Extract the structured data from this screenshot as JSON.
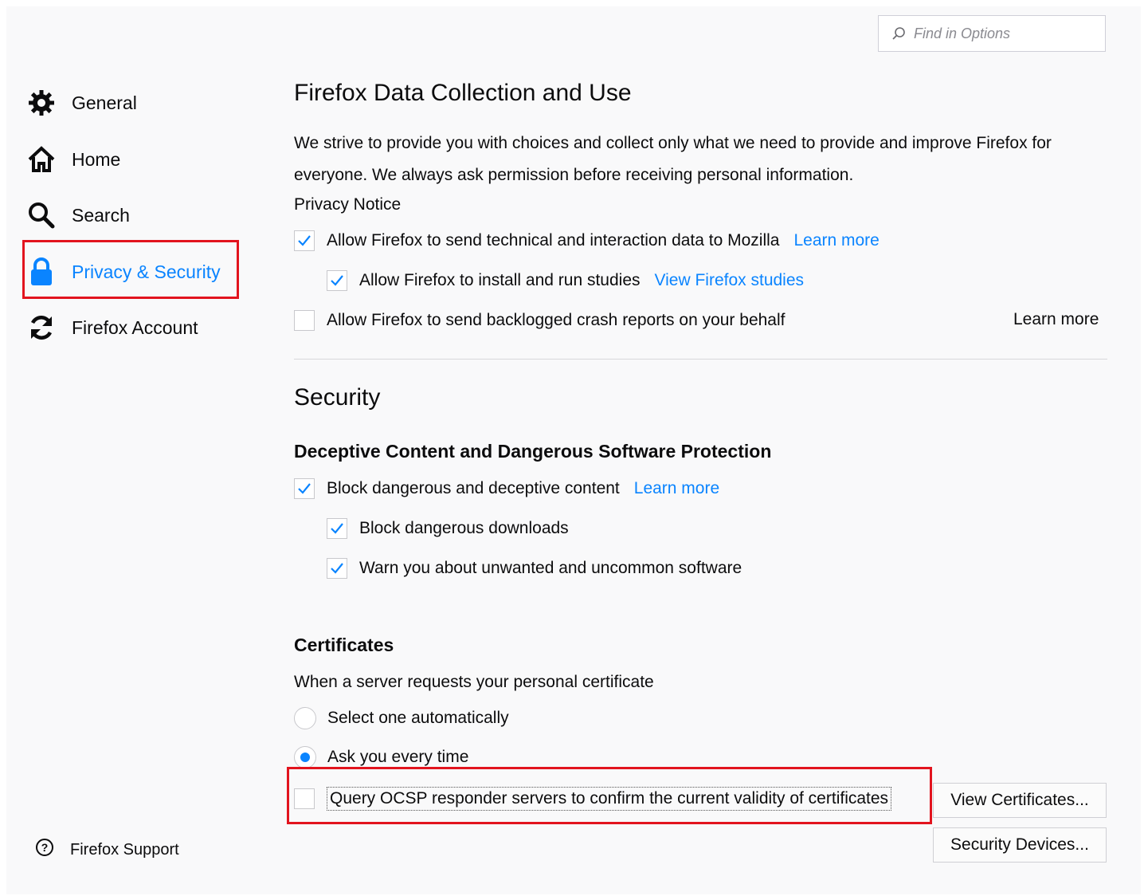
{
  "search": {
    "placeholder": "Find in Options"
  },
  "sidebar": {
    "items": [
      {
        "label": "General",
        "icon": "gear-icon"
      },
      {
        "label": "Home",
        "icon": "home-icon"
      },
      {
        "label": "Search",
        "icon": "search-icon"
      },
      {
        "label": "Privacy & Security",
        "icon": "lock-icon",
        "selected": true
      },
      {
        "label": "Firefox Account",
        "icon": "sync-icon"
      }
    ],
    "support_label": "Firefox Support"
  },
  "data_collection": {
    "title": "Firefox Data Collection and Use",
    "description": "We strive to provide you with choices and collect only what we need to provide and improve Firefox for everyone. We always ask permission before receiving personal information.",
    "privacy_notice_link": "Privacy Notice",
    "options": [
      {
        "label": "Allow Firefox to send technical and interaction data to Mozilla",
        "checked": true,
        "link": "Learn more"
      },
      {
        "label": "Allow Firefox to install and run studies",
        "checked": true,
        "link": "View Firefox studies"
      },
      {
        "label": "Allow Firefox to send backlogged crash reports on your behalf",
        "checked": false,
        "link": "Learn more"
      }
    ]
  },
  "security": {
    "title": "Security",
    "deceptive": {
      "heading": "Deceptive Content and Dangerous Software Protection",
      "options": [
        {
          "label": "Block dangerous and deceptive content",
          "checked": true,
          "link": "Learn more"
        },
        {
          "label": "Block dangerous downloads",
          "checked": true
        },
        {
          "label": "Warn you about unwanted and uncommon software",
          "checked": true
        }
      ]
    },
    "certificates": {
      "heading": "Certificates",
      "description": "When a server requests your personal certificate",
      "radio_options": [
        {
          "label": "Select one automatically",
          "selected": false
        },
        {
          "label": "Ask you every time",
          "selected": true
        }
      ],
      "ocsp_label": "Query OCSP responder servers to confirm the current validity of certificates",
      "ocsp_checked": false,
      "view_certificates_label": "View Certificates...",
      "security_devices_label": "Security Devices..."
    }
  },
  "colors": {
    "accent": "#0a84ff",
    "highlight_border": "#e2141e",
    "background": "#f9f9fa"
  }
}
